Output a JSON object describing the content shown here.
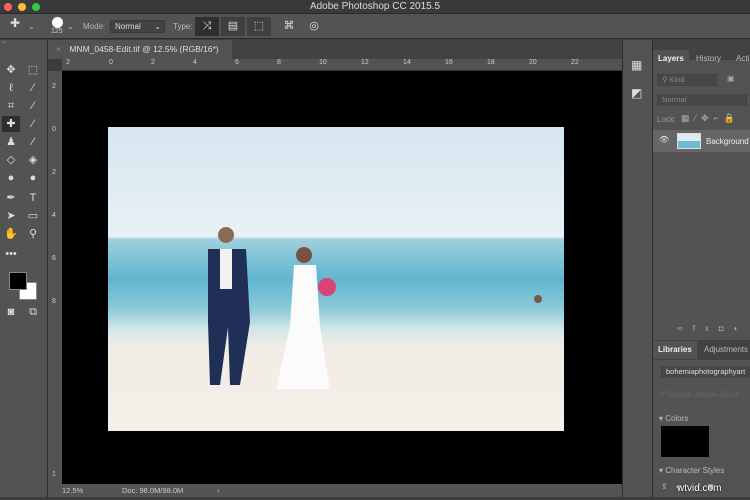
{
  "app": {
    "title": "Adobe Photoshop CC 2015.5"
  },
  "options": {
    "brush_size": "125",
    "mode_label": "Mode:",
    "mode_value": "Normal",
    "type_label": "Type:"
  },
  "document": {
    "tab_title": "MNM_0458-Edit.tif @ 12.5% (RGB/16*)",
    "close": "×"
  },
  "ruler": {
    "top": [
      "2",
      "0",
      "2",
      "4",
      "6",
      "8",
      "10",
      "12",
      "14",
      "16",
      "18",
      "20",
      "22"
    ],
    "left": [
      "2",
      "0",
      "2",
      "4",
      "6",
      "8",
      "1"
    ]
  },
  "status": {
    "zoom": "12.5%",
    "doc": "Doc: 98.0M/98.0M",
    "arrow": "›"
  },
  "layers_panel": {
    "tabs": [
      "Layers",
      "History",
      "Acti"
    ],
    "kind": "Kind",
    "blend": "Normal",
    "lock_label": "Lock:",
    "layer_name": "Background"
  },
  "libraries_panel": {
    "tabs": [
      "Libraries",
      "Adjustments"
    ],
    "library": "bohemiaphotographyart",
    "search_placeholder": "Search Adobe Stock",
    "colors": "Colors",
    "character_styles": "Character Styles",
    "color_swatch": "#000000"
  },
  "watermark": "wtvid.com"
}
